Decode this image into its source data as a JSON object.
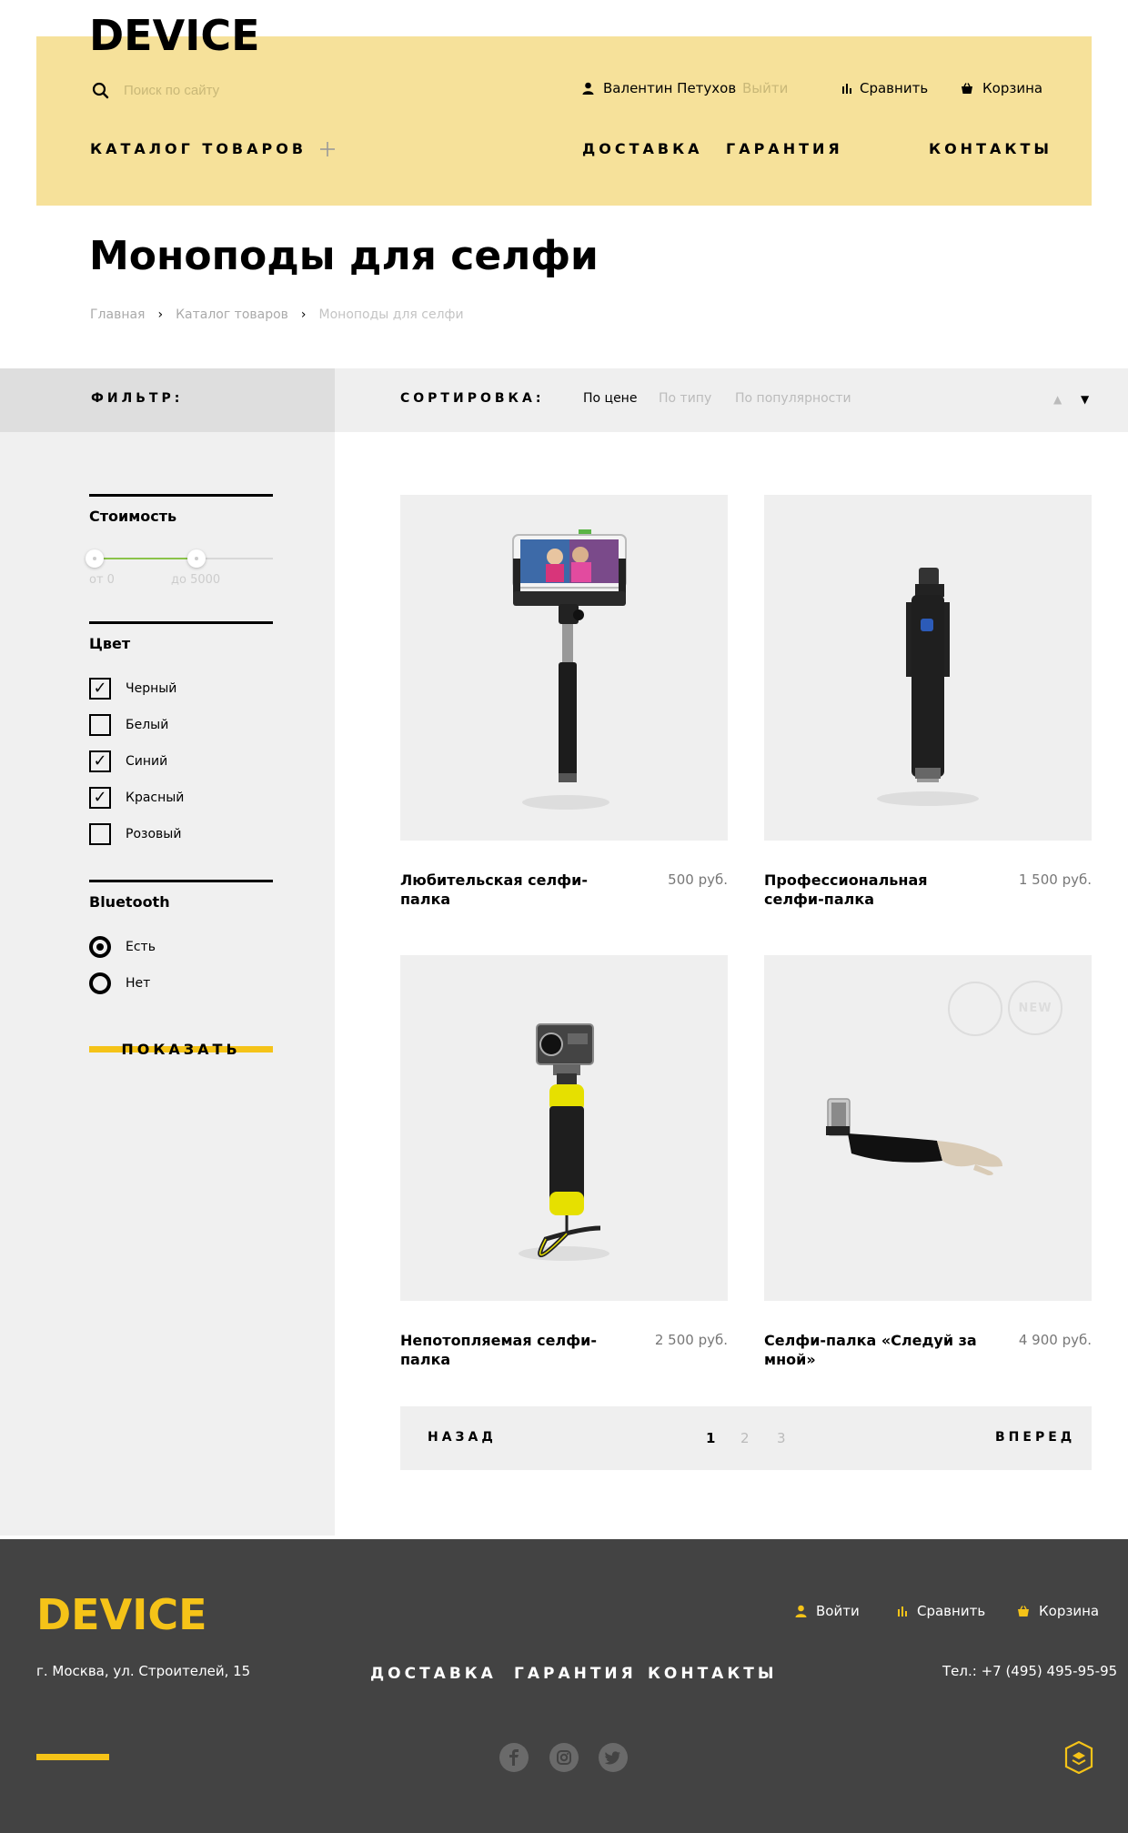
{
  "header": {
    "logo": "DEVICE",
    "search_placeholder": "Поиск по сайту",
    "user_name": "Валентин Петухов",
    "logout": "Выйти",
    "compare": "Сравнить",
    "cart": "Корзина",
    "catalog": "Каталог товаров",
    "nav": [
      "Доставка",
      "Гарантия",
      "Контакты"
    ]
  },
  "page": {
    "title": "Моноподы для селфи",
    "breadcrumbs": [
      "Главная",
      "Каталог товаров",
      "Моноподы для селфи"
    ]
  },
  "toolbar": {
    "filter_label": "Фильтр:",
    "sort_label": "Сортировка:",
    "sort_options": [
      "По цене",
      "По типу",
      "По популярности"
    ],
    "active_sort": "По цене",
    "sort_direction": "descending"
  },
  "filter": {
    "price_title": "Стоимость",
    "price_from": "от 0",
    "price_to": "до 5000",
    "color_title": "Цвет",
    "colors": [
      {
        "label": "Черный",
        "checked": true
      },
      {
        "label": "Белый",
        "checked": false
      },
      {
        "label": "Синий",
        "checked": true
      },
      {
        "label": "Красный",
        "checked": true
      },
      {
        "label": "Розовый",
        "checked": false
      }
    ],
    "bluetooth_title": "Bluetooth",
    "bluetooth_options": [
      {
        "label": "Есть",
        "selected": true
      },
      {
        "label": "Нет",
        "selected": false
      }
    ],
    "show_button": "Показать"
  },
  "products": [
    {
      "name": "Любительская селфи-палка",
      "price": "500 руб.",
      "is_new": false
    },
    {
      "name": "Профессиональная селфи-палка",
      "price": "1 500 руб.",
      "is_new": false
    },
    {
      "name": "Непотопляемая селфи-палка",
      "price": "2 500 руб.",
      "is_new": false
    },
    {
      "name": "Селфи-палка «Следуй за мной»",
      "price": "4 900 руб.",
      "is_new": true,
      "badge": "NEW"
    }
  ],
  "pagination": {
    "prev": "Назад",
    "next": "Вперед",
    "pages": [
      "1",
      "2",
      "3"
    ],
    "current": "1"
  },
  "footer": {
    "logo": "DEVICE",
    "address": "г. Москва, ул. Строителей, 15",
    "nav": [
      "Доставка",
      "Гарантия",
      "Контакты"
    ],
    "login": "Войти",
    "compare": "Сравнить",
    "cart": "Корзина",
    "phone": "Тел.: +7 (495) 495-95-95",
    "social": [
      "facebook-icon",
      "instagram-icon",
      "twitter-icon"
    ]
  },
  "colors": {
    "header_bg": "#f6e19a",
    "accent": "#f5c318",
    "footer_bg": "#434343"
  }
}
